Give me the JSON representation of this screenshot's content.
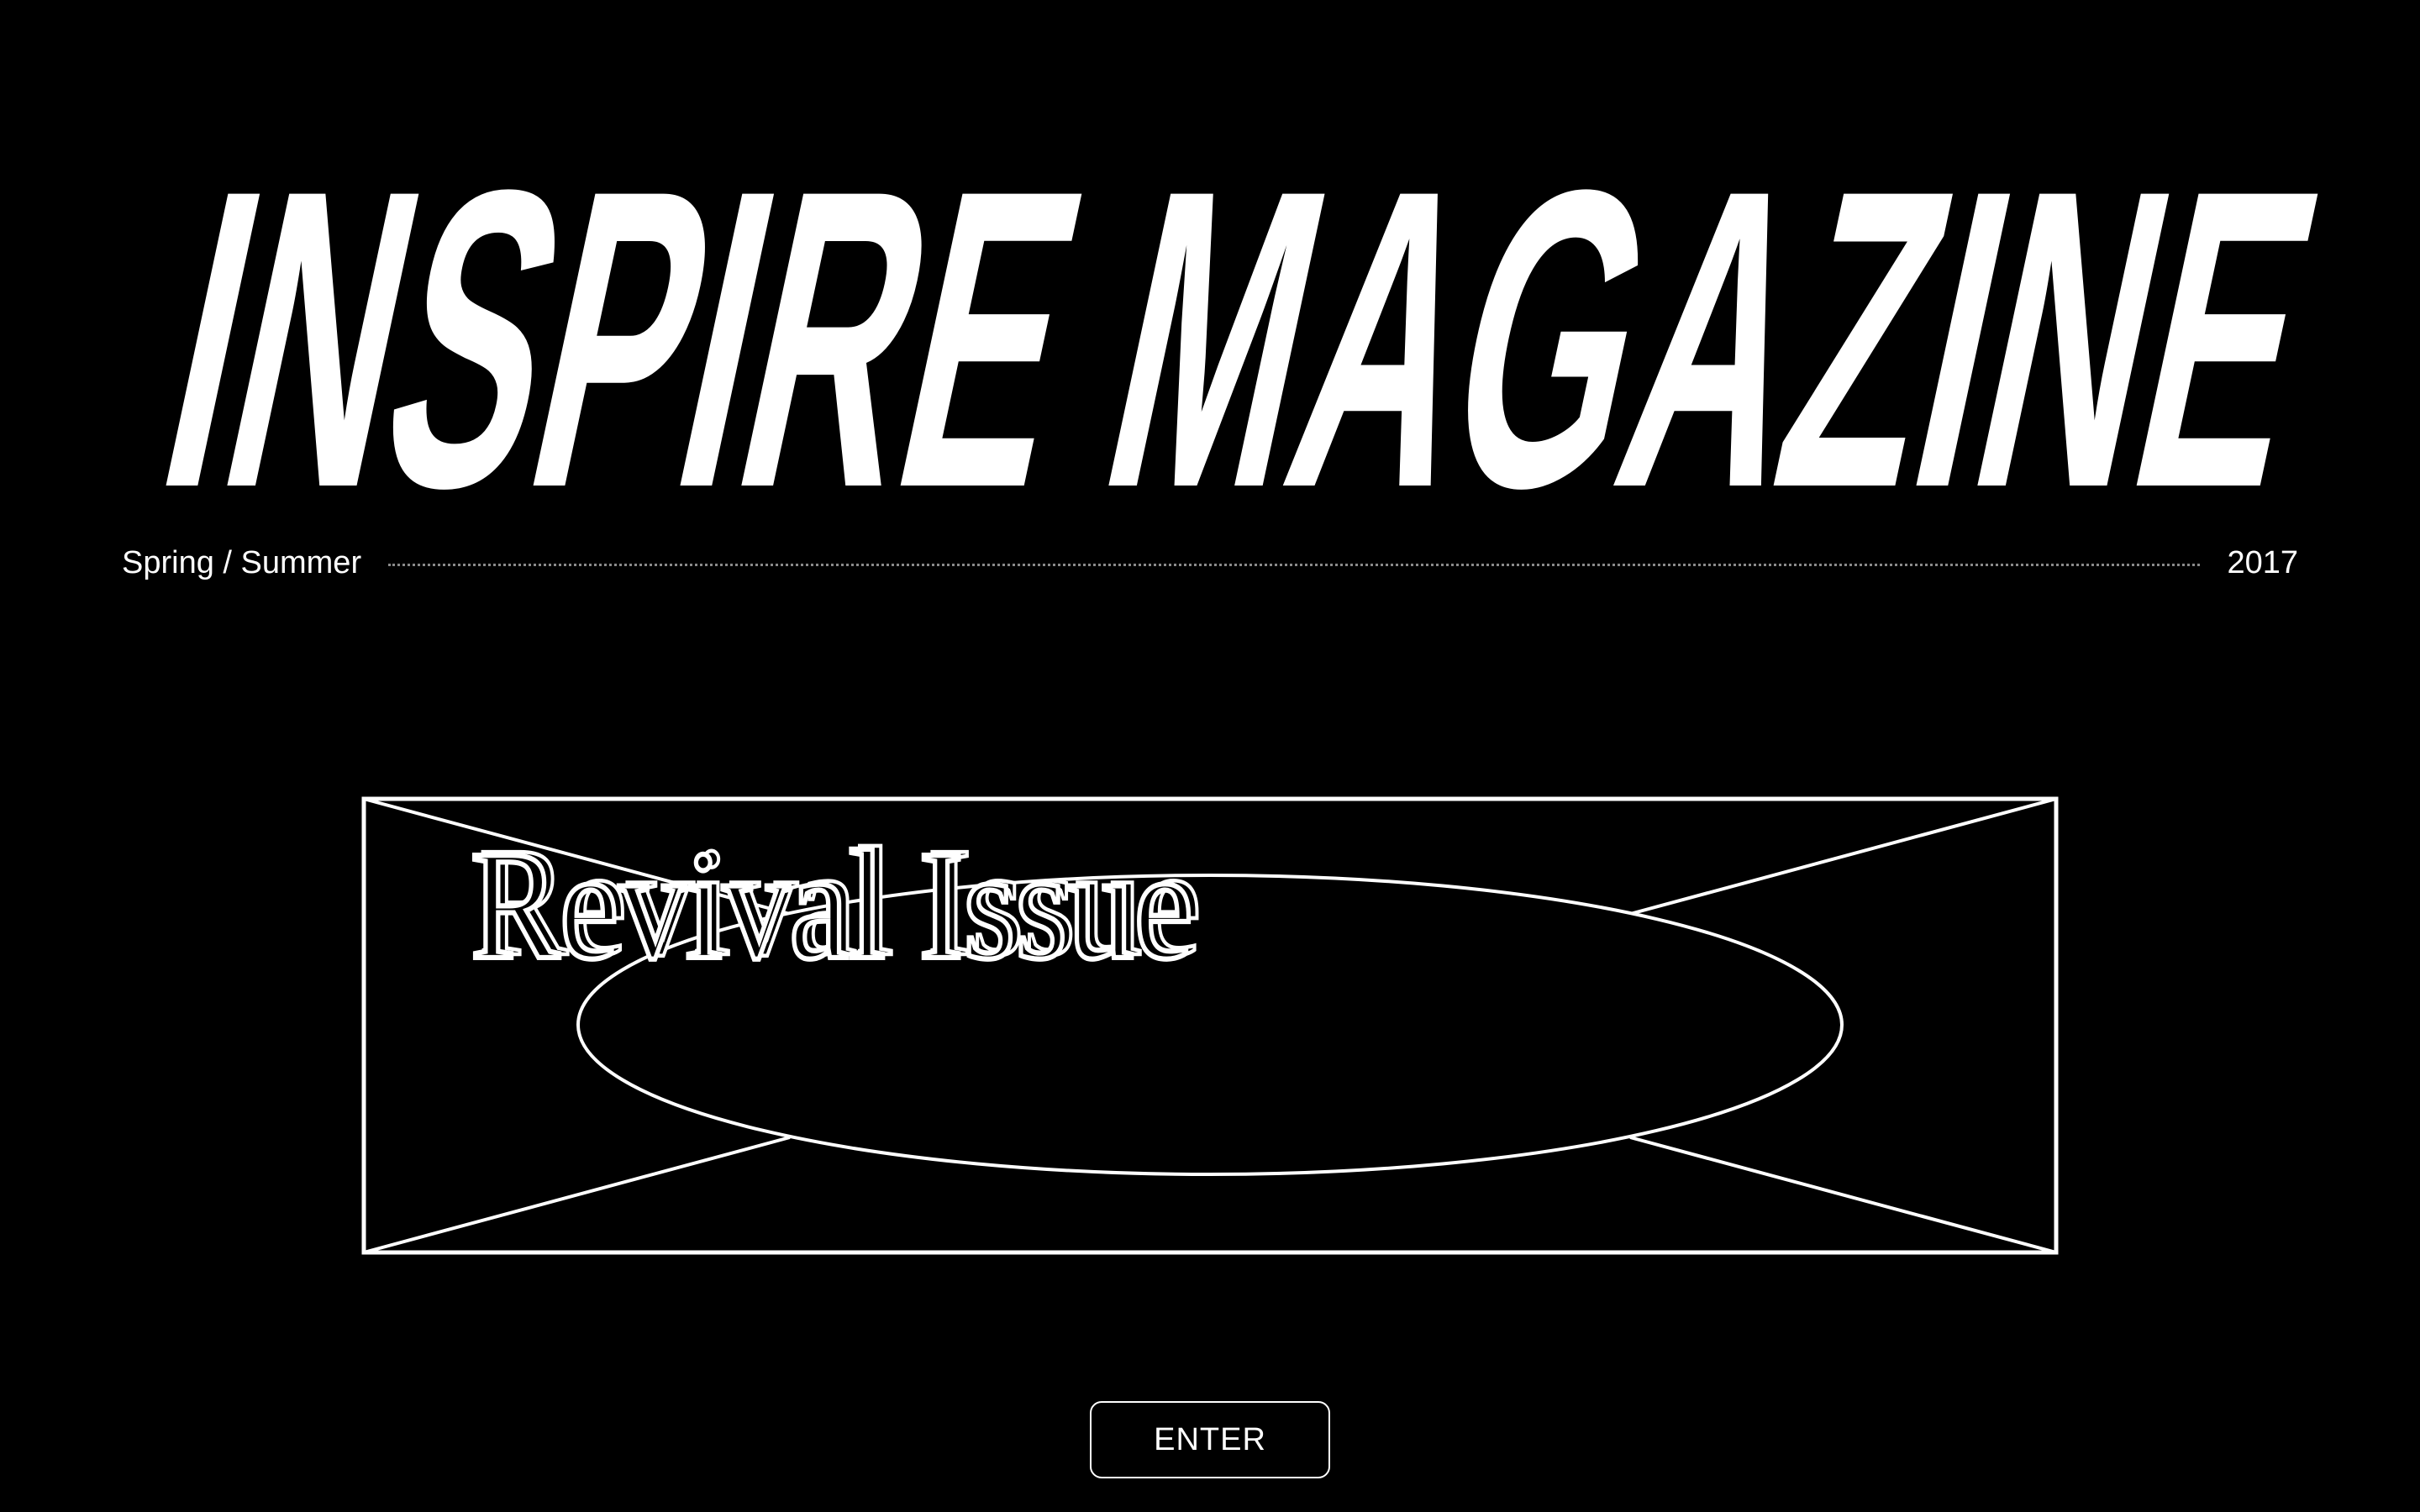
{
  "masthead": {
    "title": "INSPIRE MAGAZINE"
  },
  "issue": {
    "season": "Spring / Summer",
    "year": "2017"
  },
  "cover": {
    "label": "Revival Issue"
  },
  "enter_button": {
    "label": "ENTER"
  },
  "colors": {
    "background": "#000000",
    "foreground": "#ffffff",
    "divider": "#8a8a8a"
  }
}
